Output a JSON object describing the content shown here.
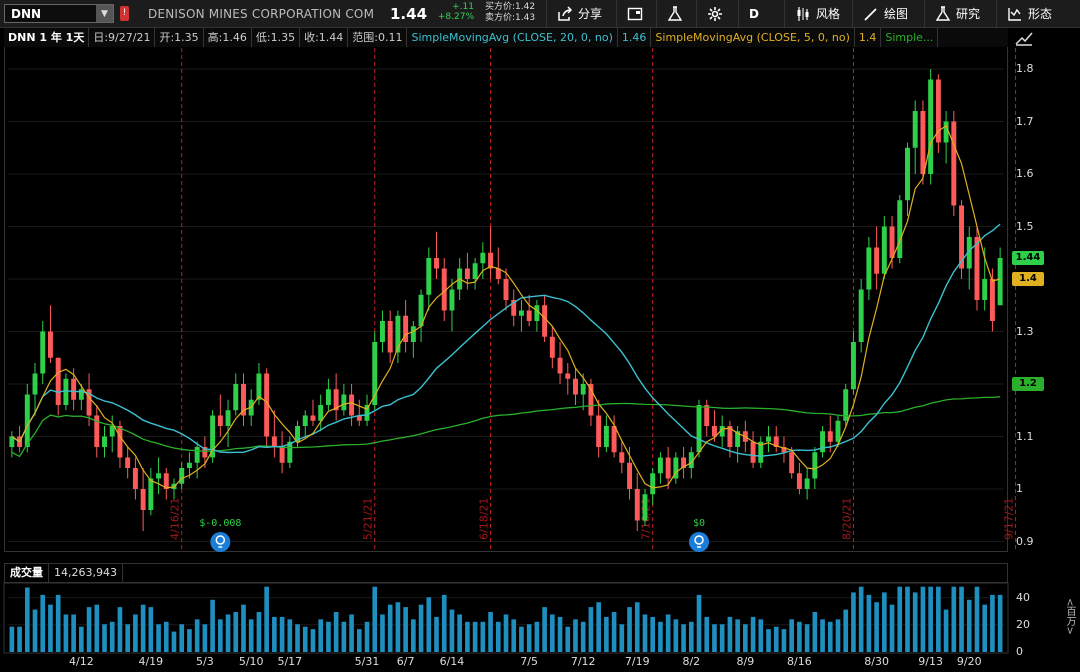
{
  "toolbar": {
    "symbol": "DNN",
    "company": "DENISON MINES CORPORATION COM",
    "last": "1.44",
    "change_abs": "+.11",
    "change_pct": "+8.27%",
    "bid": "买方价:1.42",
    "ask": "卖方价:1.43",
    "share_label": "分享",
    "timeframe_label": "D",
    "style_label": "风格",
    "draw_label": "绘图",
    "study_label": "研究",
    "pattern_label": "形态"
  },
  "legend": {
    "symbol_period": "DNN 1 年 1天",
    "date": "日:9/27/21",
    "open": "开:1.35",
    "high": "高:1.46",
    "low": "低:1.35",
    "close": "收:1.44",
    "range": "范围:0.11",
    "sma20_name": "SimpleMovingAvg (CLOSE, 20, 0, no)",
    "sma20_value": "1.46",
    "sma5_name": "SimpleMovingAvg (CLOSE, 5, 0, no)",
    "sma5_value": "1.4",
    "sma200_name": "Simple..."
  },
  "price_axis": {
    "ticks": [
      "1.8",
      "1.7",
      "1.6",
      "1.5",
      "1.4",
      "1.3",
      "1.2",
      "1.1",
      "1",
      "0.9"
    ],
    "tags": [
      {
        "label": "1.44",
        "color": "#2ed04a"
      },
      {
        "label": "1.4",
        "color": "#e0b020"
      },
      {
        "label": "1.2",
        "color": "#2ab02a"
      }
    ]
  },
  "earnings_markers": [
    {
      "label": "$-0.008",
      "date": "5/3"
    },
    {
      "label": "$0",
      "date": "8/2"
    }
  ],
  "expiration_labels": [
    "4/16/21",
    "5/21/21",
    "6/18/21",
    "7/16/21",
    "8/20/21",
    "9/17/21"
  ],
  "volume": {
    "label": "成交量",
    "value": "14,263,943",
    "unit": "<百万>",
    "ticks": [
      "40",
      "20",
      "0"
    ]
  },
  "date_axis": [
    "4/12",
    "4/19",
    "5/3",
    "5/10",
    "5/17",
    "5/31",
    "6/7",
    "6/14",
    "7/5",
    "7/12",
    "7/19",
    "8/2",
    "8/9",
    "8/16",
    "8/30",
    "9/13",
    "9/20"
  ],
  "colors": {
    "up": "#2ed04a",
    "down": "#ff5a5a",
    "sma20": "#3cc0d0",
    "sma5": "#e0b020",
    "sma200": "#2ab02a",
    "volume": "#1f8fc0",
    "expiration": "#c02020"
  },
  "chart_data": {
    "type": "candlestick",
    "ylim": [
      0.88,
      1.84
    ],
    "candles": [
      [
        1.08,
        1.11,
        1.06,
        1.1
      ],
      [
        1.1,
        1.12,
        1.07,
        1.08
      ],
      [
        1.08,
        1.2,
        1.07,
        1.18
      ],
      [
        1.18,
        1.24,
        1.14,
        1.22
      ],
      [
        1.22,
        1.32,
        1.2,
        1.3
      ],
      [
        1.3,
        1.35,
        1.24,
        1.25
      ],
      [
        1.25,
        1.25,
        1.14,
        1.16
      ],
      [
        1.16,
        1.22,
        1.15,
        1.21
      ],
      [
        1.21,
        1.23,
        1.15,
        1.17
      ],
      [
        1.17,
        1.2,
        1.15,
        1.19
      ],
      [
        1.19,
        1.22,
        1.12,
        1.14
      ],
      [
        1.14,
        1.16,
        1.06,
        1.08
      ],
      [
        1.08,
        1.12,
        1.06,
        1.1
      ],
      [
        1.1,
        1.14,
        1.07,
        1.12
      ],
      [
        1.12,
        1.13,
        1.04,
        1.06
      ],
      [
        1.06,
        1.08,
        1.02,
        1.04
      ],
      [
        1.04,
        1.06,
        0.98,
        1.0
      ],
      [
        1.0,
        1.04,
        0.92,
        0.96
      ],
      [
        0.96,
        1.04,
        0.95,
        1.02
      ],
      [
        1.02,
        1.06,
        0.99,
        1.03
      ],
      [
        1.03,
        1.04,
        0.98,
        1.0
      ],
      [
        1.0,
        1.02,
        0.98,
        1.01
      ],
      [
        1.01,
        1.05,
        1.0,
        1.04
      ],
      [
        1.04,
        1.07,
        1.02,
        1.05
      ],
      [
        1.05,
        1.09,
        1.02,
        1.08
      ],
      [
        1.08,
        1.1,
        1.04,
        1.06
      ],
      [
        1.06,
        1.15,
        1.05,
        1.14
      ],
      [
        1.14,
        1.18,
        1.1,
        1.12
      ],
      [
        1.12,
        1.17,
        1.08,
        1.15
      ],
      [
        1.15,
        1.22,
        1.14,
        1.2
      ],
      [
        1.2,
        1.22,
        1.12,
        1.14
      ],
      [
        1.14,
        1.19,
        1.12,
        1.17
      ],
      [
        1.17,
        1.24,
        1.16,
        1.22
      ],
      [
        1.22,
        1.23,
        1.08,
        1.1
      ],
      [
        1.1,
        1.15,
        1.06,
        1.08
      ],
      [
        1.08,
        1.11,
        1.03,
        1.05
      ],
      [
        1.05,
        1.1,
        1.04,
        1.09
      ],
      [
        1.09,
        1.13,
        1.08,
        1.12
      ],
      [
        1.12,
        1.15,
        1.1,
        1.14
      ],
      [
        1.14,
        1.17,
        1.12,
        1.13
      ],
      [
        1.13,
        1.18,
        1.11,
        1.16
      ],
      [
        1.16,
        1.21,
        1.15,
        1.19
      ],
      [
        1.19,
        1.22,
        1.13,
        1.15
      ],
      [
        1.15,
        1.2,
        1.14,
        1.18
      ],
      [
        1.18,
        1.2,
        1.12,
        1.14
      ],
      [
        1.14,
        1.17,
        1.12,
        1.13
      ],
      [
        1.13,
        1.18,
        1.12,
        1.16
      ],
      [
        1.16,
        1.3,
        1.15,
        1.28
      ],
      [
        1.28,
        1.34,
        1.26,
        1.32
      ],
      [
        1.32,
        1.34,
        1.24,
        1.26
      ],
      [
        1.26,
        1.34,
        1.24,
        1.33
      ],
      [
        1.33,
        1.36,
        1.26,
        1.28
      ],
      [
        1.28,
        1.32,
        1.25,
        1.31
      ],
      [
        1.31,
        1.38,
        1.28,
        1.37
      ],
      [
        1.37,
        1.46,
        1.34,
        1.44
      ],
      [
        1.44,
        1.49,
        1.4,
        1.42
      ],
      [
        1.42,
        1.44,
        1.32,
        1.34
      ],
      [
        1.34,
        1.4,
        1.3,
        1.38
      ],
      [
        1.38,
        1.44,
        1.36,
        1.42
      ],
      [
        1.42,
        1.45,
        1.38,
        1.4
      ],
      [
        1.4,
        1.44,
        1.38,
        1.43
      ],
      [
        1.43,
        1.47,
        1.4,
        1.45
      ],
      [
        1.45,
        1.5,
        1.4,
        1.42
      ],
      [
        1.42,
        1.46,
        1.39,
        1.4
      ],
      [
        1.4,
        1.42,
        1.34,
        1.36
      ],
      [
        1.36,
        1.38,
        1.31,
        1.33
      ],
      [
        1.33,
        1.36,
        1.3,
        1.34
      ],
      [
        1.34,
        1.37,
        1.31,
        1.32
      ],
      [
        1.32,
        1.36,
        1.3,
        1.35
      ],
      [
        1.35,
        1.37,
        1.28,
        1.29
      ],
      [
        1.29,
        1.31,
        1.23,
        1.25
      ],
      [
        1.25,
        1.28,
        1.2,
        1.22
      ],
      [
        1.22,
        1.24,
        1.18,
        1.21
      ],
      [
        1.21,
        1.23,
        1.16,
        1.18
      ],
      [
        1.18,
        1.22,
        1.15,
        1.2
      ],
      [
        1.2,
        1.21,
        1.12,
        1.14
      ],
      [
        1.14,
        1.17,
        1.06,
        1.08
      ],
      [
        1.08,
        1.14,
        1.07,
        1.12
      ],
      [
        1.12,
        1.14,
        1.06,
        1.07
      ],
      [
        1.07,
        1.09,
        1.03,
        1.05
      ],
      [
        1.05,
        1.08,
        0.98,
        1.0
      ],
      [
        1.0,
        1.03,
        0.92,
        0.94
      ],
      [
        0.94,
        1.0,
        0.93,
        0.99
      ],
      [
        0.99,
        1.04,
        0.97,
        1.03
      ],
      [
        1.03,
        1.07,
        1.01,
        1.06
      ],
      [
        1.06,
        1.08,
        1.0,
        1.02
      ],
      [
        1.02,
        1.07,
        1.01,
        1.06
      ],
      [
        1.06,
        1.08,
        1.02,
        1.04
      ],
      [
        1.04,
        1.08,
        1.02,
        1.07
      ],
      [
        1.07,
        1.17,
        1.06,
        1.16
      ],
      [
        1.16,
        1.17,
        1.1,
        1.12
      ],
      [
        1.12,
        1.15,
        1.09,
        1.1
      ],
      [
        1.1,
        1.14,
        1.08,
        1.12
      ],
      [
        1.12,
        1.13,
        1.06,
        1.08
      ],
      [
        1.08,
        1.12,
        1.05,
        1.11
      ],
      [
        1.11,
        1.13,
        1.07,
        1.09
      ],
      [
        1.09,
        1.11,
        1.04,
        1.05
      ],
      [
        1.05,
        1.1,
        1.04,
        1.09
      ],
      [
        1.09,
        1.12,
        1.07,
        1.1
      ],
      [
        1.1,
        1.12,
        1.07,
        1.08
      ],
      [
        1.08,
        1.1,
        1.05,
        1.07
      ],
      [
        1.07,
        1.08,
        1.02,
        1.03
      ],
      [
        1.03,
        1.05,
        0.99,
        1.0
      ],
      [
        1.0,
        1.04,
        0.98,
        1.02
      ],
      [
        1.02,
        1.08,
        1.0,
        1.07
      ],
      [
        1.07,
        1.12,
        1.06,
        1.11
      ],
      [
        1.11,
        1.14,
        1.07,
        1.09
      ],
      [
        1.09,
        1.14,
        1.08,
        1.13
      ],
      [
        1.13,
        1.2,
        1.12,
        1.19
      ],
      [
        1.19,
        1.3,
        1.18,
        1.28
      ],
      [
        1.28,
        1.4,
        1.26,
        1.38
      ],
      [
        1.38,
        1.48,
        1.36,
        1.46
      ],
      [
        1.46,
        1.5,
        1.38,
        1.41
      ],
      [
        1.41,
        1.52,
        1.4,
        1.5
      ],
      [
        1.5,
        1.52,
        1.42,
        1.44
      ],
      [
        1.44,
        1.56,
        1.43,
        1.55
      ],
      [
        1.55,
        1.66,
        1.52,
        1.65
      ],
      [
        1.65,
        1.74,
        1.6,
        1.72
      ],
      [
        1.72,
        1.74,
        1.58,
        1.6
      ],
      [
        1.6,
        1.8,
        1.58,
        1.78
      ],
      [
        1.78,
        1.79,
        1.64,
        1.66
      ],
      [
        1.66,
        1.72,
        1.62,
        1.7
      ],
      [
        1.7,
        1.72,
        1.52,
        1.54
      ],
      [
        1.54,
        1.55,
        1.4,
        1.42
      ],
      [
        1.42,
        1.5,
        1.38,
        1.48
      ],
      [
        1.48,
        1.5,
        1.34,
        1.36
      ],
      [
        1.36,
        1.46,
        1.34,
        1.4
      ],
      [
        1.4,
        1.42,
        1.3,
        1.32
      ],
      [
        1.35,
        1.46,
        1.35,
        1.44
      ]
    ]
  }
}
